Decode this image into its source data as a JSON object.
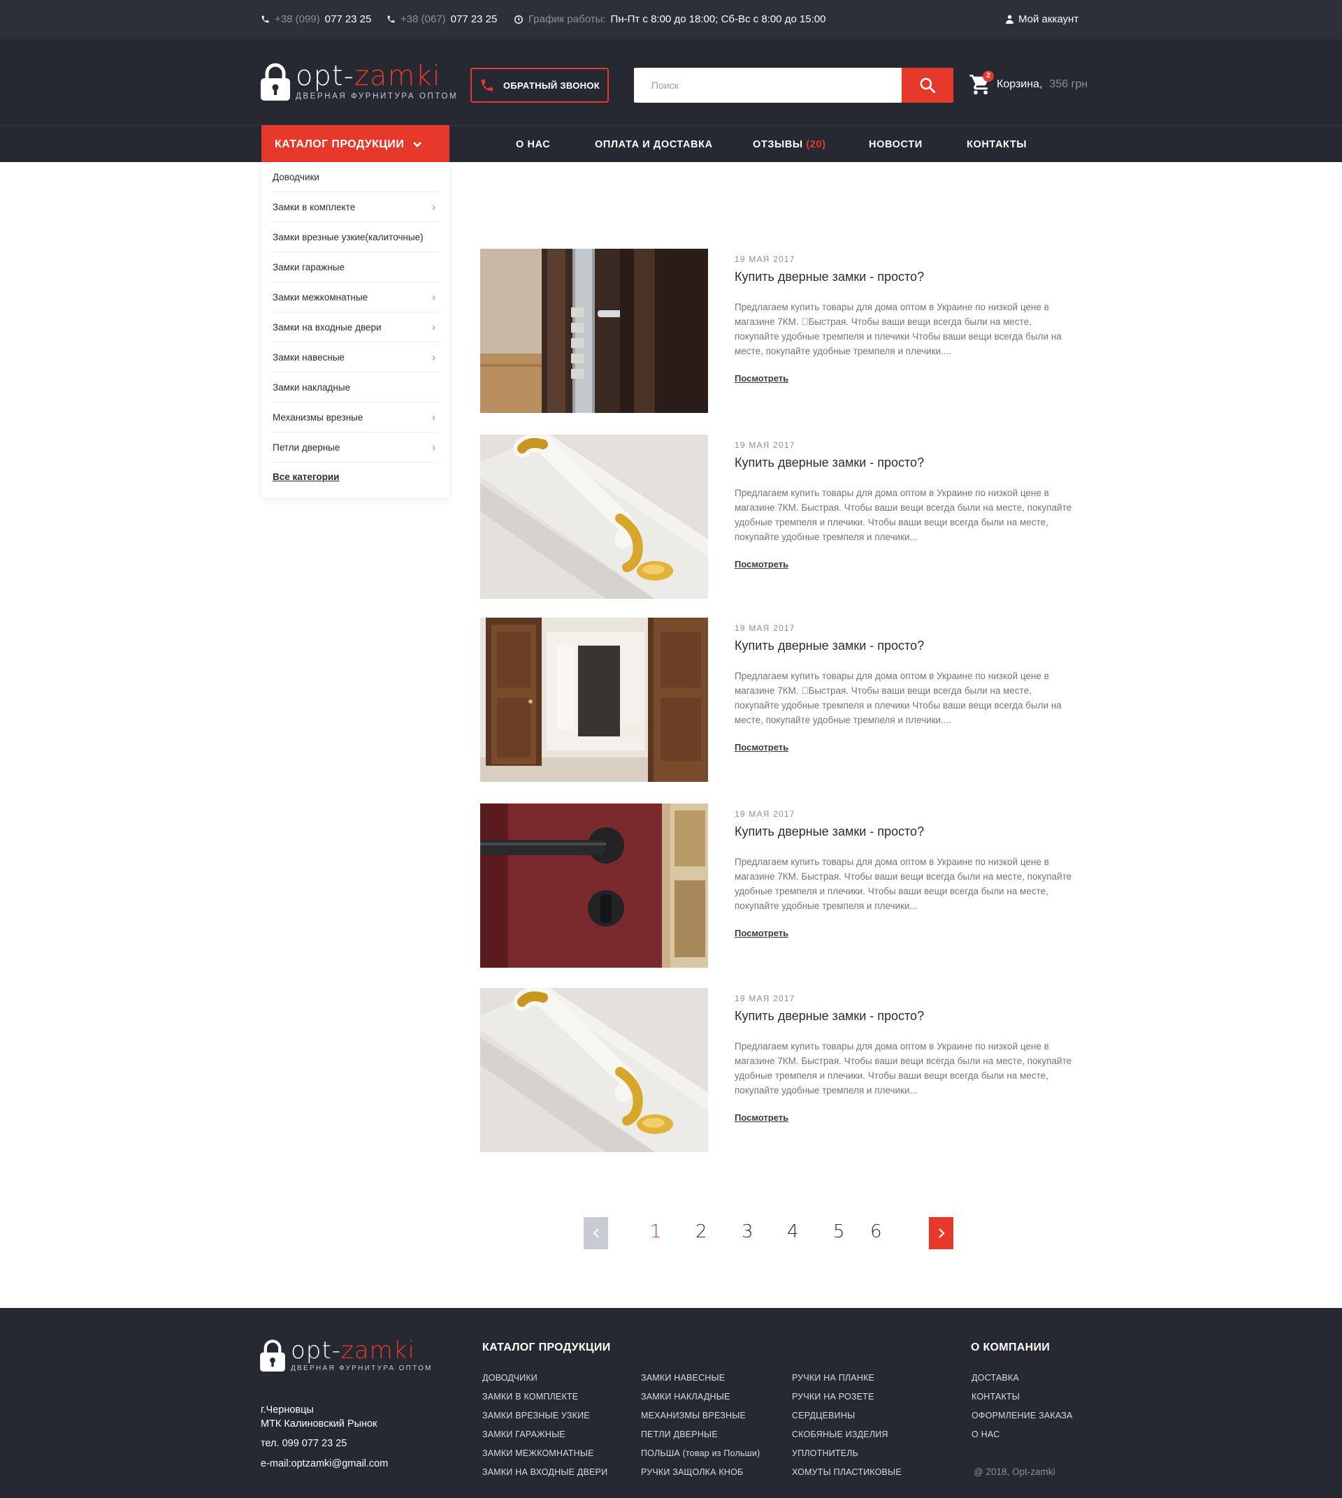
{
  "topbar": {
    "phone1_prefix": "+38 (099)",
    "phone1_number": "077 23 25",
    "phone2_prefix": "+38 (067)",
    "phone2_number": "077 23 25",
    "schedule_label": "График работы:",
    "schedule_value": "Пн-Пт с 8:00 до 18:00; Сб-Вс с  8:00 до 15:00",
    "account": "Мой аккаунт"
  },
  "header": {
    "brand_a": "opt-",
    "brand_b": "zamki",
    "brand_sub": "ДВЕРНАЯ ФУРНИТУРА ОПТОМ",
    "callback": "ОБРАТНЫЙ ЗВОНОК",
    "search_placeholder": "Поиск",
    "cart_count": "2",
    "cart_label": "Корзина,",
    "cart_price": "356 грн"
  },
  "nav": {
    "catalog": "КАТАЛОГ ПРОДУКЦИИ",
    "about": "О НАС",
    "payment": "ОПЛАТА И ДОСТАВКА",
    "reviews": "ОТЗЫВЫ",
    "reviews_count": "(20)",
    "news": "НОВОСТИ",
    "contacts": "КОНТАКТЫ"
  },
  "sidebar": {
    "items": [
      {
        "label": "Доводчики",
        "arrow": ""
      },
      {
        "label": "Замки в комплекте",
        "arrow": "›"
      },
      {
        "label": "Замки врезные узкие(калиточные)",
        "arrow": ""
      },
      {
        "label": "Замки гаражные",
        "arrow": ""
      },
      {
        "label": "Замки межкомнатные",
        "arrow": "›"
      },
      {
        "label": "Замки на входные двери",
        "arrow": "›"
      },
      {
        "label": "Замки навесные",
        "arrow": "›"
      },
      {
        "label": "Замки накладные",
        "arrow": ""
      },
      {
        "label": "Механизмы врезные",
        "arrow": "›"
      },
      {
        "label": "Петли дверные",
        "arrow": "›"
      }
    ],
    "all": "Все категории"
  },
  "news": [
    {
      "date": "19 МАЯ 2017",
      "title": "Купить дверные замки -  просто?",
      "text": "Предлагаем купить товары для дома оптом в Украине по низкой цене в магазине 7КМ. \u0000Быстрая. Чтобы ваши вещи всегда были на месте, покупайте удобные тремпеля и плечики Чтобы ваши вещи всегда были на месте, покупайте удобные тремпеля и плечики....",
      "more": "Посмотреть",
      "image": "door-lock-image"
    },
    {
      "date": "19 МАЯ 2017",
      "title": "Купить дверные замки -  просто?",
      "text": "Предлагаем купить товары для дома оптом в Украине по низкой цене в магазине 7КМ. Быстрая. Чтобы ваши вещи всегда были на месте, покупайте удобные тремпеля и плечики. Чтобы ваши вещи всегда были на месте, покупайте удобные тремпеля и плечики...",
      "more": "Посмотреть",
      "image": "gold-handle-image"
    },
    {
      "date": "19 МАЯ 2017",
      "title": "Купить дверные замки -  просто?",
      "text": "Предлагаем купить товары для дома оптом в Украине по низкой цене в магазине 7КМ. \u0000Быстрая. Чтобы ваши вещи всегда были на месте, покупайте удобные тремпеля и плечики Чтобы ваши вещи всегда были на месте, покупайте удобные тремпеля и плечики....",
      "more": "Посмотреть",
      "image": "interior-doors-image"
    },
    {
      "date": "19 МАЯ 2017",
      "title": "Купить дверные замки -  просто?",
      "text": "Предлагаем купить товары для дома оптом в Украине по низкой цене в магазине 7КМ. Быстрая. Чтобы ваши вещи всегда были на месте, покупайте удобные тремпеля и плечики. Чтобы ваши вещи всегда были на месте, покупайте удобные тремпеля и плечики...",
      "more": "Посмотреть",
      "image": "black-handle-image"
    },
    {
      "date": "19 МАЯ 2017",
      "title": "Купить дверные замки -  просто?",
      "text": "Предлагаем купить товары для дома оптом в Украине по низкой цене в магазине 7КМ. Быстрая. Чтобы ваши вещи всегда были на месте, покупайте удобные тремпеля и плечики. Чтобы ваши вещи всегда были на месте, покупайте удобные тремпеля и плечики...",
      "more": "Посмотреть",
      "image": "gold-handle-image"
    }
  ],
  "pagination": {
    "pages": [
      "1",
      "2",
      "3",
      "4",
      "5",
      "6"
    ],
    "current": "1"
  },
  "footer": {
    "city": "г.Черновцы",
    "market": "МТК Калиновский Рынок",
    "phone": "тел. 099 077 23 25",
    "email": "e-mail:optzamki@gmail.com",
    "catalog_title": "КАТАЛОГ ПРОДУКЦИИ",
    "col1": [
      "ДОВОДЧИКИ",
      "ЗАМКИ В КОМПЛЕКТЕ",
      "ЗАМКИ ВРЕЗНЫЕ УЗКИЕ",
      "ЗАМКИ ГАРАЖНЫЕ",
      "ЗАМКИ МЕЖКОМНАТНЫЕ",
      "ЗАМКИ НА ВХОДНЫЕ ДВЕРИ"
    ],
    "col2": [
      "ЗАМКИ НАВЕСНЫЕ",
      "ЗАМКИ НАКЛАДНЫЕ",
      "МЕХАНИЗМЫ ВРЕЗНЫЕ",
      "ПЕТЛИ ДВЕРНЫЕ",
      "ПОЛЬША (товар из Польши)",
      "РУЧКИ ЗАЩОЛКА КНОБ"
    ],
    "col3": [
      "РУЧКИ НА ПЛАНКЕ",
      "РУЧКИ НА РОЗЕТЕ",
      "СЕРДЦЕВИНЫ",
      "СКОБЯНЫЕ ИЗДЕЛИЯ",
      "УПЛОТНИТЕЛЬ",
      "ХОМУТЫ ПЛАСТИКОВЫЕ"
    ],
    "company_title": "О КОМПАНИИ",
    "col4": [
      "ДОСТАВКА",
      "КОНТАКТЫ",
      "ОФОРМЛЕНИЕ ЗАКАЗА",
      "О НАС"
    ],
    "copyright": "@ 2018, Opt-zamki"
  },
  "colors": {
    "accent": "#e6392b",
    "dark": "#262932",
    "topbar": "#2d3039"
  }
}
